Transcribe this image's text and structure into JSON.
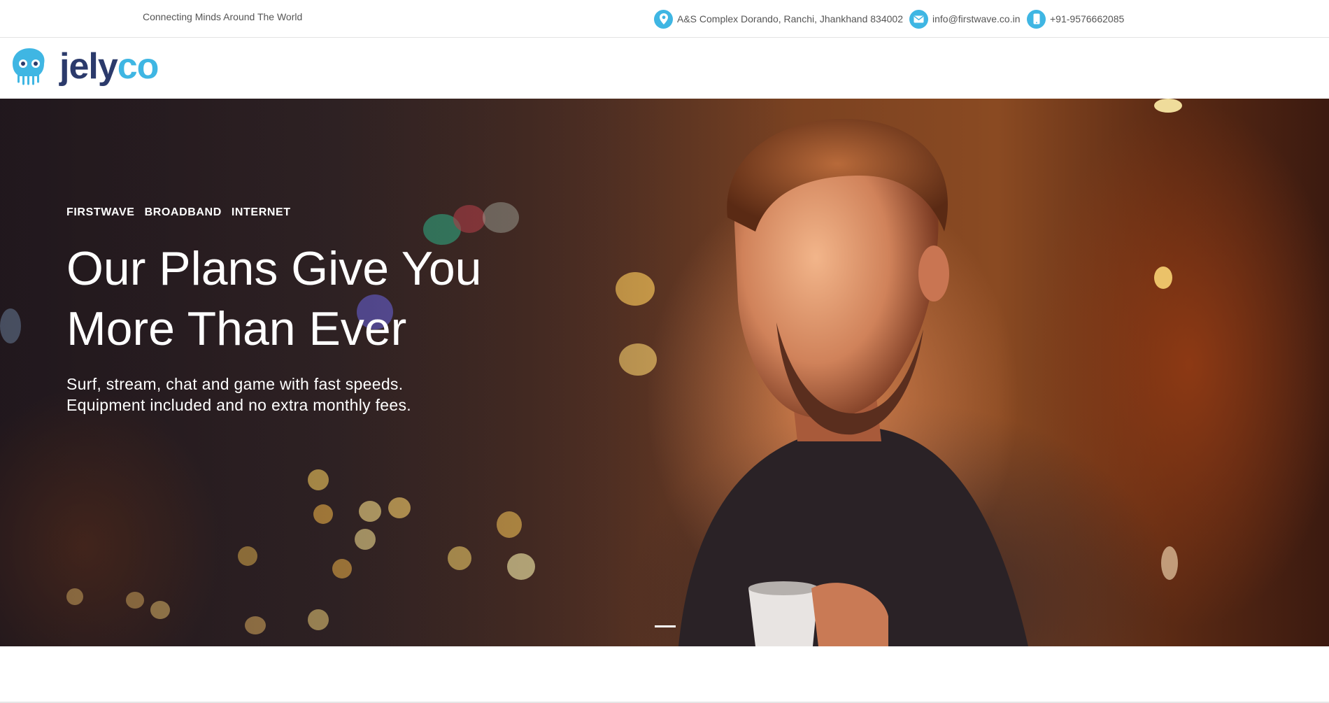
{
  "topbar": {
    "tagline": "Connecting Minds Around The World",
    "address": "A&S Complex Dorando, Ranchi, Jhankhand 834002",
    "email": "info@firstwave.co.in",
    "phone": "+91-9576662085",
    "icons": [
      "location-pin-icon",
      "envelope-icon",
      "mobile-phone-icon"
    ],
    "icon_color": "#3fb6e3"
  },
  "logo": {
    "text_part1": "jely",
    "text_part2": "co",
    "color_primary": "#2b3a6b",
    "color_accent": "#3fb6e3"
  },
  "hero": {
    "kicker": [
      "FIRSTWAVE",
      "BROADBAND",
      "INTERNET"
    ],
    "headline_line1": "Our Plans Give You",
    "headline_line2": "More Than Ever",
    "sub_line1": "Surf, stream, chat and game with fast speeds.",
    "sub_line2": "Equipment included and no extra monthly fees.",
    "active_slide": 1
  }
}
